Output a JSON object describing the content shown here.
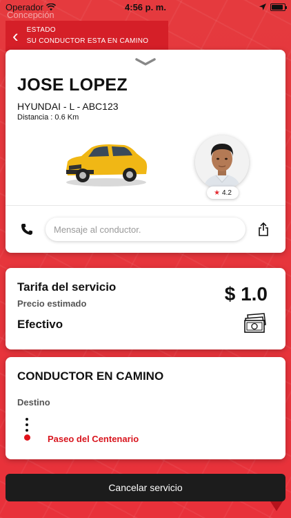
{
  "status_bar": {
    "carrier": "Operador",
    "time": "4:56 p. m."
  },
  "map": {
    "place_label": "Concepción"
  },
  "estado": {
    "title": "ESTADO",
    "message": "SU CONDUCTOR ESTA EN CAMINO"
  },
  "driver": {
    "name": "JOSE LOPEZ",
    "vehicle": "HYUNDAI - L - ABC123",
    "distance": "Distancia : 0.6 Km",
    "rating": "4.2",
    "message_placeholder": "Mensaje al conductor."
  },
  "fare": {
    "title": "Tarifa del servicio",
    "subtitle": "Precio estimado",
    "amount": "$ 1.0",
    "payment_method": "Efectivo"
  },
  "route": {
    "title": "CONDUCTOR EN CAMINO",
    "destination_label": "Destino",
    "destination": "Paseo del Centenario"
  },
  "actions": {
    "cancel_label": "Cancelar servicio"
  },
  "colors": {
    "brand_red": "#e8343a",
    "banner_red": "#d51f28",
    "destination_red": "#d8141d",
    "button_dark": "#1c1c1c"
  },
  "icons": [
    "wifi-icon",
    "location-arrow-icon",
    "battery-icon",
    "back-chevron-icon",
    "collapse-chevron-icon",
    "phone-icon",
    "share-icon",
    "cash-icon",
    "star-icon"
  ]
}
